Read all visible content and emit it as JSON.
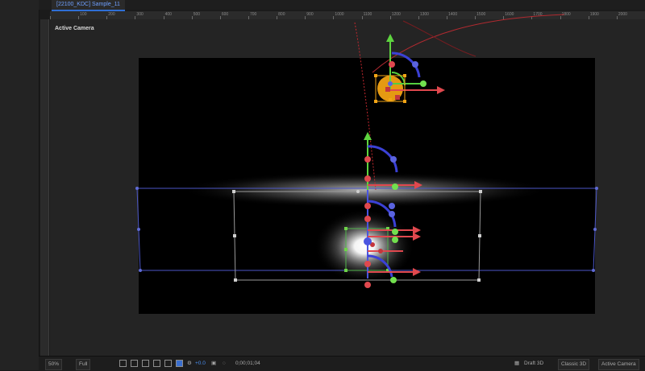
{
  "tab": {
    "label": "[22100_KDC] Sample_11"
  },
  "viewer": {
    "label": "Active Camera"
  },
  "ruler": {
    "top_ticks": [
      " ",
      "100",
      "200",
      "300",
      "400",
      "500",
      "600",
      "700",
      "800",
      "900",
      "1000",
      "1100",
      "1200",
      "1300",
      "1400",
      "1500",
      "1600",
      "1700",
      "1800",
      "1900",
      "2000"
    ]
  },
  "statusbar": {
    "zoom": "50%",
    "resolution": "Full",
    "exposure": "+0.0",
    "timecode": "0;00;01;04",
    "renderer": "Draft 3D",
    "renderer_mode": "Classic 3D",
    "view": "Active Camera"
  },
  "colors": {
    "accent": "#2f6fd6",
    "x_axis": "#e0484e",
    "y_axis": "#6fd34a",
    "z_axis": "#4a55e0",
    "gizmo_gold": "#f2a516"
  }
}
